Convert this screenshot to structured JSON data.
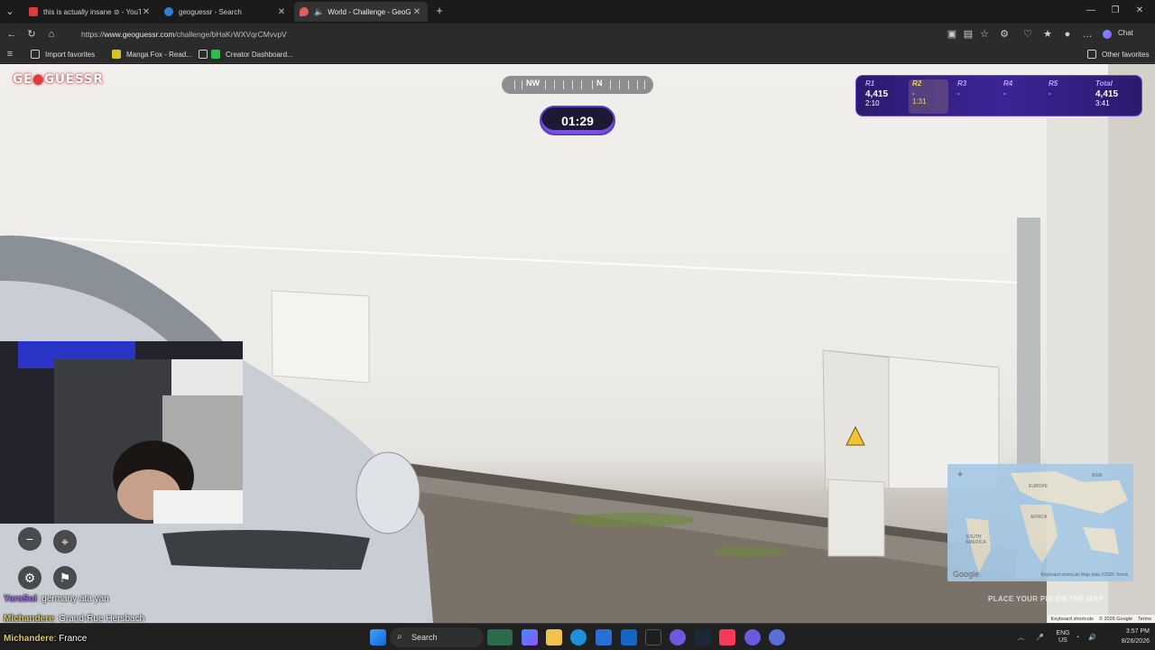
{
  "browser": {
    "tabs": [
      {
        "title": "this is actually insane ⊘ - YouTub",
        "active": false
      },
      {
        "title": "geoguessr - Search",
        "active": false
      },
      {
        "title": "World - Challenge - GeoGues",
        "active": true
      }
    ],
    "address": {
      "prefix": "https://",
      "host": "www.geoguessr.com",
      "path": "/challenge/bHaKrWXVqrCMvvpV"
    },
    "chat_label": "Chat",
    "favorites": [
      {
        "label": "Import favorites"
      },
      {
        "label": "Manga Fox - Read..."
      },
      {
        "label": "Creator Dashboard..."
      }
    ],
    "other_favorites": "Other favorites"
  },
  "game": {
    "logo": {
      "pre": "GE",
      "pin": "●",
      "post": "GUESSR"
    },
    "compass": {
      "left_label": "NW",
      "right_label": "N"
    },
    "timer": "01:29",
    "rounds": [
      {
        "label": "R1",
        "score": "4,415",
        "time": "2:10",
        "current": false
      },
      {
        "label": "R2",
        "score": "-",
        "time": "1:31",
        "current": true
      },
      {
        "label": "R3",
        "score": "-",
        "time": "",
        "current": false
      },
      {
        "label": "R4",
        "score": "-",
        "time": "",
        "current": false
      },
      {
        "label": "R5",
        "score": "-",
        "time": "",
        "current": false
      },
      {
        "label": "Total",
        "score": "4,415",
        "time": "3:41",
        "current": false
      }
    ],
    "place_pin_text": "PLACE YOUR PIN ON THE MAP",
    "minimap": {
      "labels": [
        "EUROPE",
        "ASIA",
        "AFRICA",
        "SOUTH AMERICA"
      ],
      "google": "Google",
      "footer": "Keyboard shortcuts  Map data ©2026  Terms"
    },
    "attribution": {
      "shortcuts": "Keyboard shortcuts",
      "copyright": "© 2026 Google",
      "terms": "Terms"
    },
    "controls": {
      "zoom_out": "−",
      "pin": "⌖",
      "settings": "⚙",
      "flag": "⚑"
    }
  },
  "chat": [
    {
      "user": "YaraSui",
      "message": ": germany ata yan",
      "user_color": "#a56bff"
    },
    {
      "user": "Michandere",
      "message": ": Grand-Rue Hersbach",
      "user_color": "#e8c84a"
    },
    {
      "user": "Michandere",
      "message": ": France",
      "user_color": "#e8c84a"
    }
  ],
  "taskbar": {
    "search_placeholder": "Search",
    "lang": "ENG",
    "region": "US",
    "time": "3:57 PM",
    "date": "8/26/2026"
  }
}
